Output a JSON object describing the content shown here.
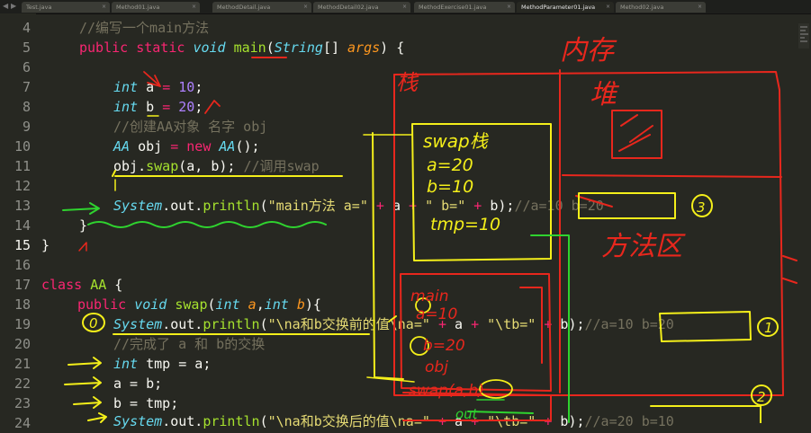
{
  "tabs": [
    {
      "label": "Test.java",
      "active": false
    },
    {
      "label": "Method01.java",
      "active": false
    },
    {
      "label": "MethodDetail.java",
      "active": false
    },
    {
      "label": "MethodDetail02.java",
      "active": false
    },
    {
      "label": "MethodExercise01.java",
      "active": false
    },
    {
      "label": "MethodParameter01.java",
      "active": true
    },
    {
      "label": "Method02.java",
      "active": false
    }
  ],
  "line_numbers": [
    "4",
    "5",
    "6",
    "7",
    "8",
    "9",
    "10",
    "11",
    "12",
    "13",
    "14",
    "15",
    "16",
    "17",
    "18",
    "19",
    "20",
    "21",
    "22",
    "23",
    "24"
  ],
  "current_line": "15",
  "code": {
    "l4": "//编写一个main方法",
    "l5_public": "public",
    "l5_static": "static",
    "l5_void": "void",
    "l5_main": "main",
    "l5_string": "String",
    "l5_br": "[]",
    "l5_args": "args",
    "l5_end": ") {",
    "l7_int": "int",
    "l7_a": "a",
    "l7_eq": "=",
    "l7_num": "10",
    "l7_end": ";",
    "l8_int": "int",
    "l8_b": "b",
    "l8_eq": "=",
    "l8_num": "20",
    "l8_end": ";",
    "l9": "//创建AA对象 名字 obj",
    "l10_aa": "AA",
    "l10_obj": "obj",
    "l10_eq": "=",
    "l10_new": "new",
    "l10_aa2": "AA",
    "l10_end": "();",
    "l11_obj": "obj",
    "l11_swap": "swap",
    "l11_args": "(a, b);",
    "l11_cm": "//调用swap",
    "l13_sys": "System",
    "l13_out": ".out.",
    "l13_println": "println",
    "l13_open": "(",
    "l13_s1": "\"main方法 a=\"",
    "l13_p1": "+",
    "l13_a": "a",
    "l13_p2": "+",
    "l13_s2": "\" b=\"",
    "l13_p3": "+",
    "l13_b": "b",
    "l13_end": ");",
    "l13_cm": "//a=10 b=20",
    "l14": "}",
    "l15": "}",
    "l17_class": "class",
    "l17_aa": "AA",
    "l17_end": "{",
    "l18_public": "public",
    "l18_void": "void",
    "l18_swap": "swap",
    "l18_open": "(",
    "l18_int1": "int",
    "l18_a": "a",
    "l18_comma": ",",
    "l18_int2": "int",
    "l18_b": "b",
    "l18_end": "){",
    "l19_sys": "System",
    "l19_out": ".out.",
    "l19_println": "println",
    "l19_open": "(",
    "l19_s1": "\"\\na和b交换前的值\\na=\"",
    "l19_p1": "+",
    "l19_a": "a",
    "l19_p2": "+",
    "l19_s2": "\"\\tb=\"",
    "l19_p3": "+",
    "l19_b": "b",
    "l19_end": ");",
    "l19_cm": "//a=10 b=20",
    "l20": "//完成了 a 和 b的交换",
    "l21_int": "int",
    "l21_tmp": "tmp",
    "l21_rest": "= a;",
    "l22": "a = b;",
    "l23": "b = tmp;",
    "l24_sys": "System",
    "l24_out": ".out.",
    "l24_println": "println",
    "l24_open": "(",
    "l24_s1": "\"\\na和b交换后的值\\na=\"",
    "l24_p1": "+",
    "l24_a": "a",
    "l24_p2": "+",
    "l24_s2": "\"\\tb=\"",
    "l24_p3": "+",
    "l24_b": "b",
    "l24_end": ");",
    "l24_cm": "//a=20 b=10"
  },
  "annotations": {
    "memory": "内存",
    "heap": "堆",
    "stack": "栈",
    "method_area": "方法区",
    "swap_stack": "swap栈",
    "swap_a": "a=20",
    "swap_b": "b=10",
    "swap_tmp": "tmp=10",
    "main_label": "main",
    "main_a": "a=10",
    "main_b": "b=20",
    "main_obj": "obj",
    "swap_call": "swap(a,b)",
    "out_label": "out",
    "circle_0": "0",
    "circle_1": "1",
    "circle_2": "2",
    "circle_3": "3"
  },
  "colors": {
    "background": "#272822",
    "keyword": "#f92672",
    "type": "#66d9ef",
    "function": "#a6e22e",
    "string": "#e6db74",
    "number": "#ae81ff",
    "comment": "#75715e",
    "param": "#fd971f",
    "ink_red": "#e8271d",
    "ink_yellow": "#f4ef1a",
    "ink_green": "#2fd32f"
  }
}
